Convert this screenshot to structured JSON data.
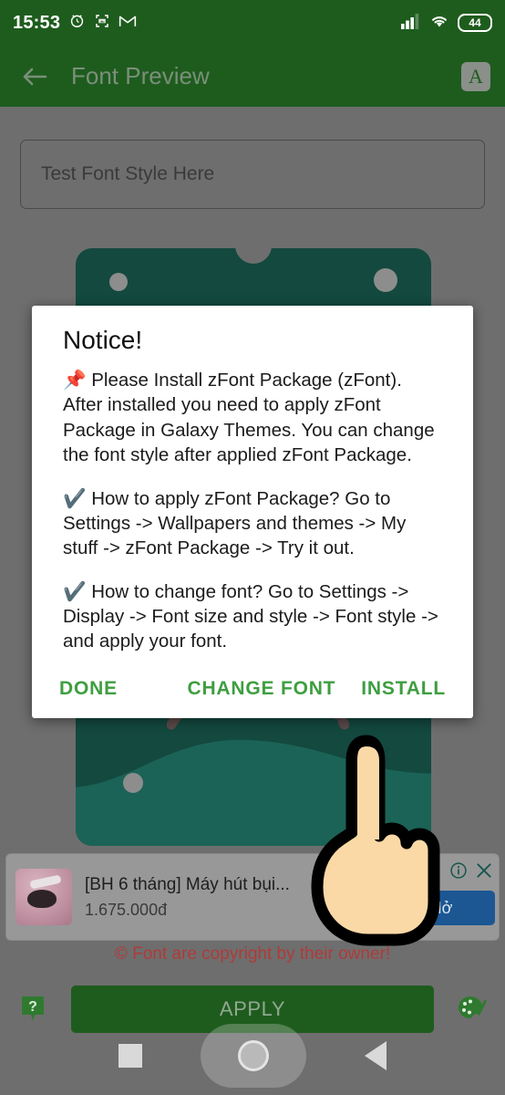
{
  "status_bar": {
    "time": "15:53",
    "icons_left": [
      "alarm-icon",
      "screenshot-icon",
      "gmail-icon"
    ],
    "icons_right": [
      "signal-icon",
      "wifi-icon"
    ],
    "battery_level": "44"
  },
  "app_bar": {
    "title": "Font Preview",
    "back_icon": "back-arrow-icon",
    "font_toggle_label": "A"
  },
  "preview": {
    "input_value": "Test Font Style Here"
  },
  "dialog": {
    "title": "Notice!",
    "paragraph_1": "📌 Please Install zFont Package (zFont).\nAfter installed you need to apply zFont Package in Galaxy Themes.\nYou can change the font style after applied zFont Package.",
    "paragraph_2": "✔️ How to apply zFont Package?\nGo to Settings -> Wallpapers and themes -> My stuff -> zFont Package -> Try it out.",
    "paragraph_3": "✔️ How to change font?\nGo to Settings -> Display -> Font size and style -> Font style -> and apply your font.",
    "buttons": {
      "done": "DONE",
      "change_font": "CHANGE FONT",
      "install": "INSTALL"
    },
    "accent_color": "#3e9e40"
  },
  "ad": {
    "title": "[BH 6 tháng] Máy hút bụi...",
    "price": "1.675.000đ",
    "cta_label": "Mở",
    "info_icon": "info-icon",
    "close_icon": "close-icon",
    "thumbnail_name": "robot-vacuum-thumbnail"
  },
  "footer": {
    "copyright": "© Font are copyright by their owner!",
    "copyright_color": "#b03a3a",
    "apply_label": "APPLY",
    "help_icon": "help-icon",
    "palette_icon": "palette-icon"
  },
  "nav_bar": {
    "recents_icon": "recents-square-icon",
    "home_icon": "home-circle-icon",
    "back_icon": "back-triangle-icon"
  },
  "overlay": {
    "cursor_icon": "pointing-hand-cursor"
  },
  "theme": {
    "app_bar_green": "#1e5c1e",
    "card_teal": "#13493f",
    "scrim_grey": "#6e6e6e",
    "ad_blue": "#1c5794"
  }
}
